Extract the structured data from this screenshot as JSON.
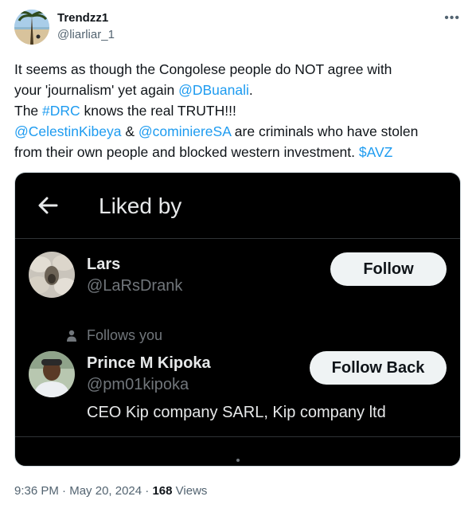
{
  "tweet": {
    "author_name": "Trendzz1",
    "author_handle": "@liarliar_1",
    "more_icon": "more-horizontal-icon",
    "text": {
      "l1": "It seems as though the Congolese people do NOT agree with",
      "l2_a": "your 'journalism' yet again ",
      "l2_link": "@DBuanali",
      "l2_b": ".",
      "l3_a": "The ",
      "l3_link": "#DRC",
      "l3_b": " knows the real TRUTH!!!",
      "l4_link1": "@CelestinKibeya",
      "l4_mid": " & ",
      "l4_link2": "@cominiereSA",
      "l4_b": " are criminals who have stolen",
      "l5_a": "from their own people and blocked western investment. ",
      "l5_link": "$AVZ"
    },
    "footer": {
      "time": "9:36 PM",
      "sep1": " · ",
      "date": "May 20, 2024",
      "sep2": " · ",
      "views_count": "168",
      "views_label": " Views"
    }
  },
  "media": {
    "back_icon": "arrow-left-icon",
    "title": "Liked by",
    "users": [
      {
        "name": "Lars",
        "handle": "@LaRsDrank",
        "button": "Follow"
      },
      {
        "follows_you": "Follows you",
        "name": "Prince M Kipoka",
        "handle": "@pm01kipoka",
        "bio": "CEO Kip company SARL, Kip company ltd",
        "button": "Follow Back"
      }
    ]
  },
  "colors": {
    "link": "#1d9bf0",
    "text": "#0f1419",
    "muted": "#536471",
    "media_bg": "#000000"
  }
}
